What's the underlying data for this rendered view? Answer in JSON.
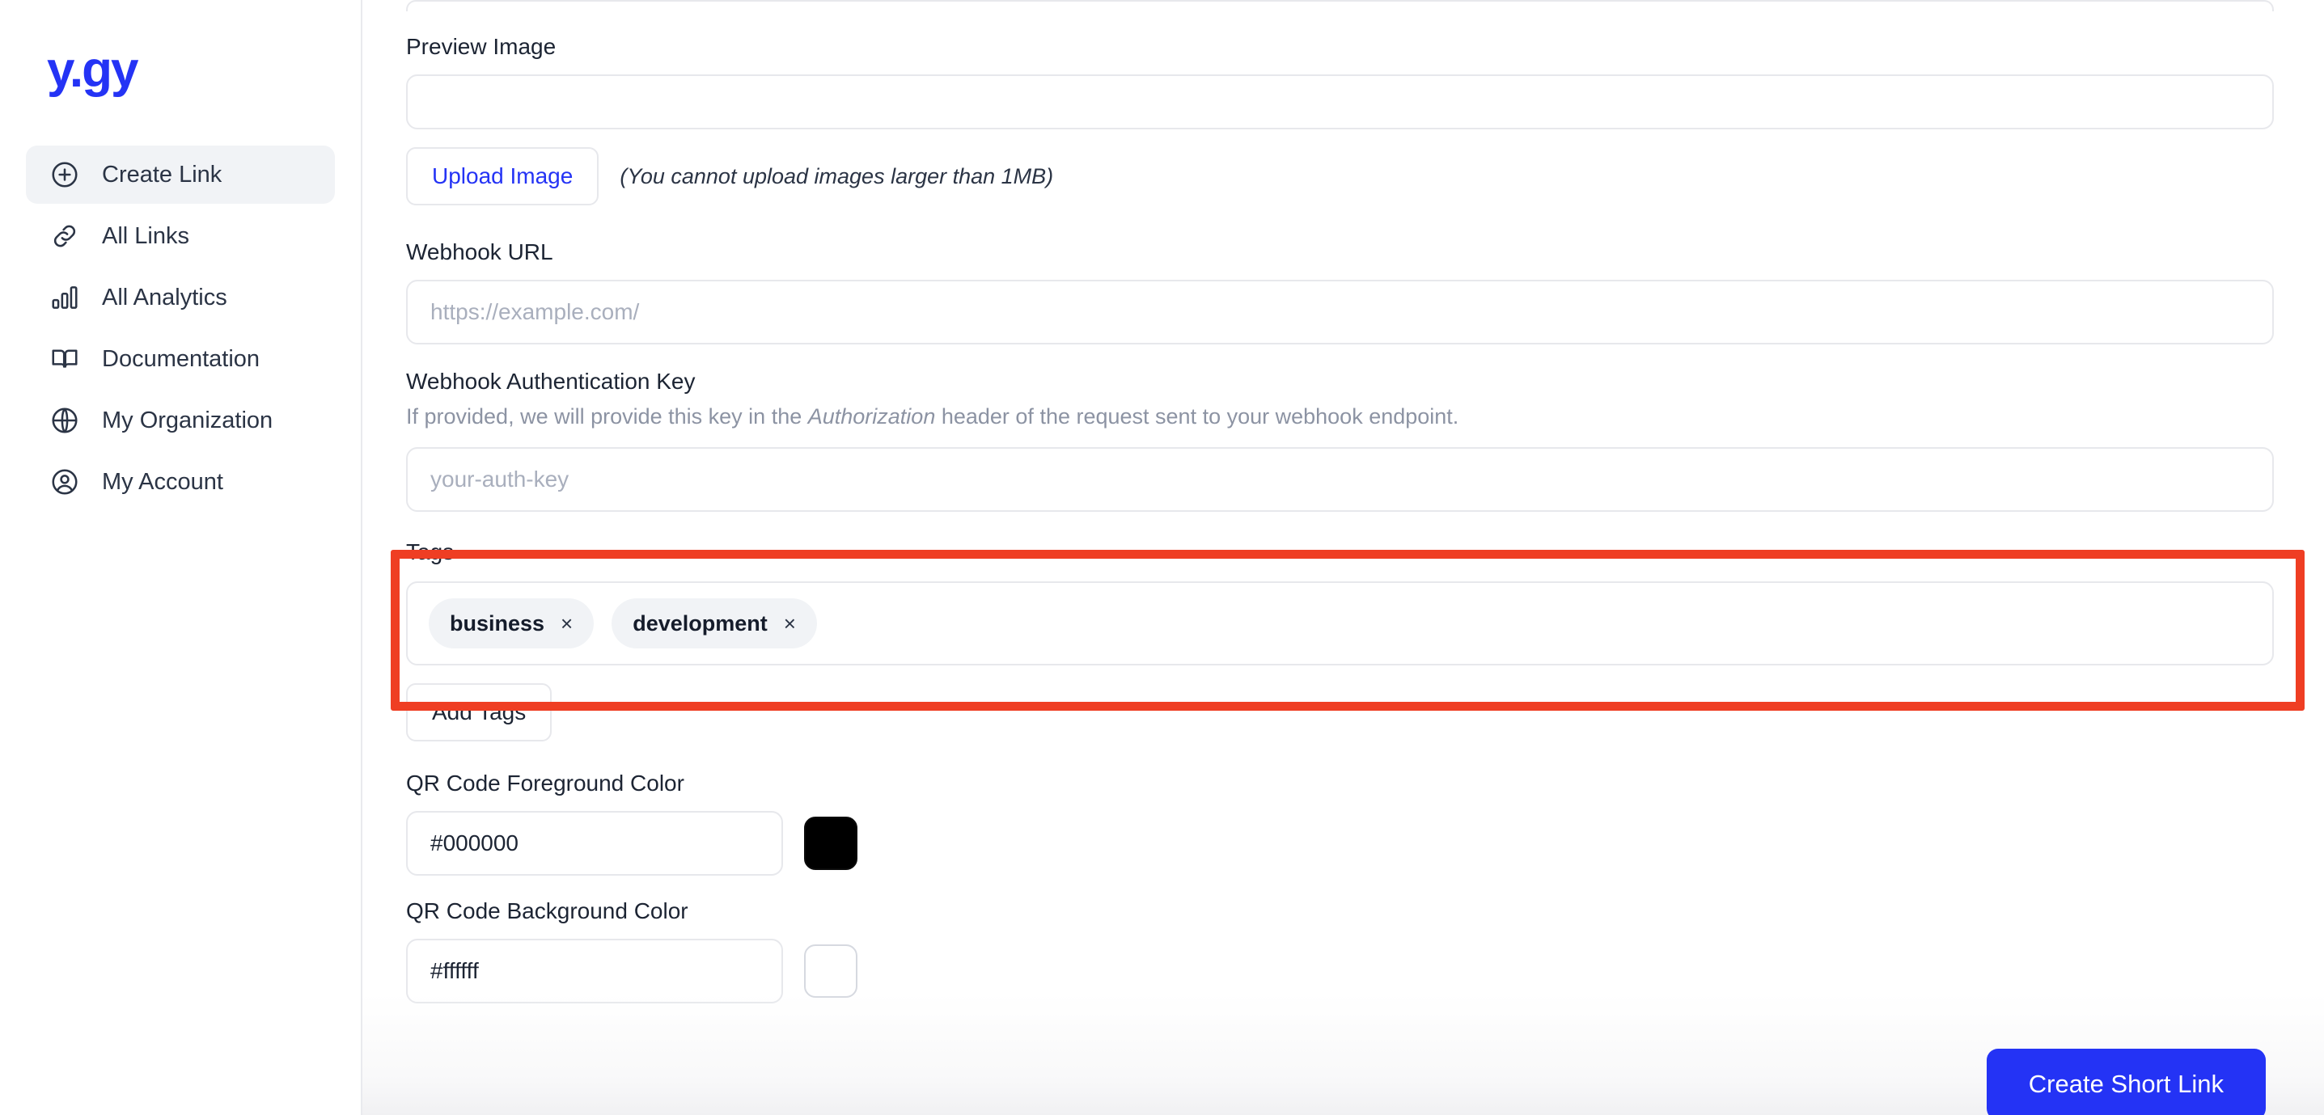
{
  "brand": {
    "logo_text": "y.gy",
    "logo_color": "#2433f5"
  },
  "sidebar": {
    "items": [
      {
        "label": "Create Link",
        "icon": "plus-circle-icon",
        "active": true
      },
      {
        "label": "All Links",
        "icon": "link-icon",
        "active": false
      },
      {
        "label": "All Analytics",
        "icon": "bar-chart-icon",
        "active": false
      },
      {
        "label": "Documentation",
        "icon": "book-icon",
        "active": false
      },
      {
        "label": "My Organization",
        "icon": "globe-icon",
        "active": false
      },
      {
        "label": "My Account",
        "icon": "user-circle-icon",
        "active": false
      }
    ]
  },
  "form": {
    "preview_image": {
      "label": "Preview Image",
      "upload_button": "Upload Image",
      "note": "(You cannot upload images larger than 1MB)"
    },
    "webhook_url": {
      "label": "Webhook URL",
      "placeholder": "https://example.com/",
      "value": ""
    },
    "webhook_auth_key": {
      "label": "Webhook Authentication Key",
      "hint_before": "If provided, we will provide this key in the ",
      "hint_italic": "Authorization",
      "hint_after": " header of the request sent to your webhook endpoint.",
      "placeholder": "your-auth-key",
      "value": ""
    },
    "tags": {
      "label": "Tags",
      "items": [
        {
          "name": "business",
          "remove": "×"
        },
        {
          "name": "development",
          "remove": "×"
        }
      ],
      "add_button": "Add Tags"
    },
    "qr_foreground": {
      "label": "QR Code Foreground Color",
      "value": "#000000",
      "swatch_color": "#000000"
    },
    "qr_background": {
      "label": "QR Code Background Color",
      "value": "#ffffff",
      "swatch_color": "#ffffff"
    }
  },
  "footer": {
    "submit_label": "Create Short Link",
    "submit_color": "#2433f5"
  },
  "annotation": {
    "color": "#ef3e23",
    "target": "tags-section"
  }
}
